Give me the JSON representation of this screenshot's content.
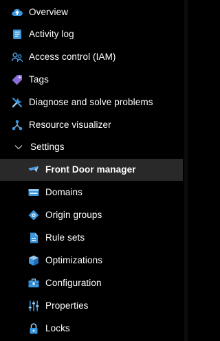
{
  "nav": {
    "items": [
      {
        "label": "Overview",
        "icon": "overview-cloud-icon"
      },
      {
        "label": "Activity log",
        "icon": "activity-log-icon"
      },
      {
        "label": "Access control (IAM)",
        "icon": "access-control-people-icon"
      },
      {
        "label": "Tags",
        "icon": "tag-icon"
      },
      {
        "label": "Diagnose and solve problems",
        "icon": "wrench-icon"
      },
      {
        "label": "Resource visualizer",
        "icon": "resource-visualizer-icon"
      }
    ],
    "settings": {
      "label": "Settings",
      "icon": "chevron-down-icon",
      "expanded": true,
      "children": [
        {
          "label": "Front Door manager",
          "icon": "front-door-icon",
          "selected": true
        },
        {
          "label": "Domains",
          "icon": "domains-icon"
        },
        {
          "label": "Origin groups",
          "icon": "origin-groups-icon"
        },
        {
          "label": "Rule sets",
          "icon": "rule-sets-icon"
        },
        {
          "label": "Optimizations",
          "icon": "optimizations-cube-icon"
        },
        {
          "label": "Configuration",
          "icon": "configuration-toolbox-icon"
        },
        {
          "label": "Properties",
          "icon": "properties-sliders-icon"
        },
        {
          "label": "Locks",
          "icon": "lock-icon"
        }
      ]
    }
  },
  "colors": {
    "background": "#000000",
    "selected_background": "#292929",
    "text": "#ffffff",
    "accent_blue": "#3a96dd"
  }
}
